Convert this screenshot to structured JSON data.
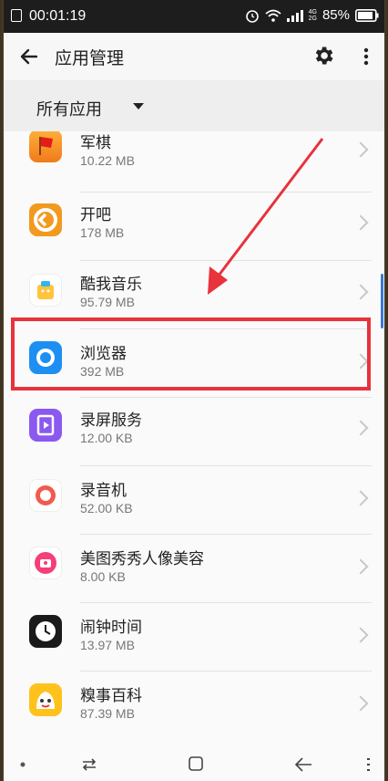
{
  "status_bar": {
    "time": "00:01:19",
    "signal_top": "4G",
    "signal_bottom": "2G",
    "battery": "85%"
  },
  "app_bar": {
    "title": "应用管理"
  },
  "filter": {
    "label": "所有应用"
  },
  "apps": [
    {
      "name": "军棋",
      "size": "10.22 MB"
    },
    {
      "name": "开吧",
      "size": "178 MB"
    },
    {
      "name": "酷我音乐",
      "size": "95.79 MB"
    },
    {
      "name": "浏览器",
      "size": "392 MB"
    },
    {
      "name": "录屏服务",
      "size": "12.00 KB"
    },
    {
      "name": "录音机",
      "size": "52.00 KB"
    },
    {
      "name": "美图秀秀人像美容",
      "size": "8.00 KB"
    },
    {
      "name": "闹钟时间",
      "size": "13.97 MB"
    },
    {
      "name": "糗事百科",
      "size": "87.39 MB"
    }
  ],
  "colors": {
    "highlight": "#e8323c",
    "arrow": "#e8323c"
  }
}
